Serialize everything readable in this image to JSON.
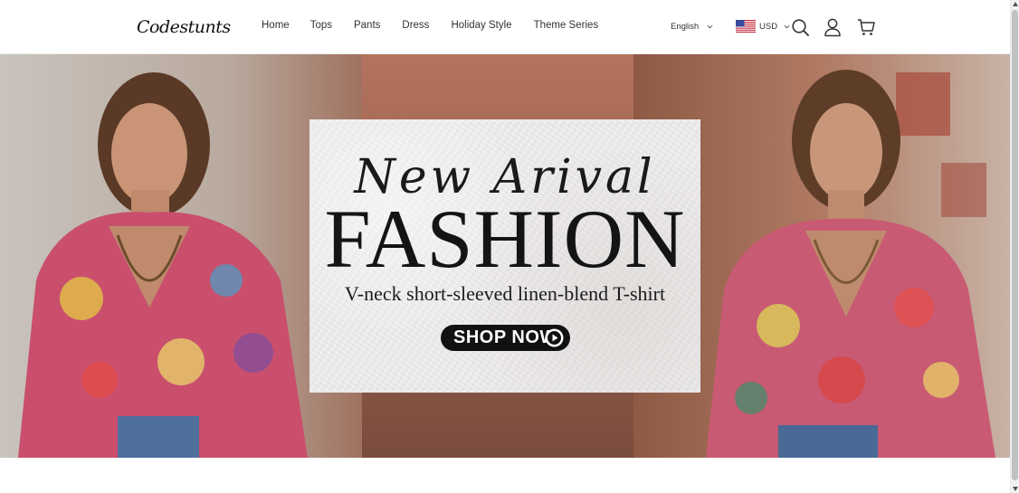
{
  "brand": {
    "name": "Codestunts"
  },
  "nav": {
    "items": [
      {
        "label": "Home"
      },
      {
        "label": "Tops"
      },
      {
        "label": "Pants"
      },
      {
        "label": "Dress"
      },
      {
        "label": "Holiday Style"
      },
      {
        "label": "Theme Series"
      }
    ]
  },
  "header": {
    "language": "English",
    "currency": "USD",
    "flag_icon": "us-flag-icon",
    "icons": [
      "search-icon",
      "account-icon",
      "cart-icon"
    ]
  },
  "hero": {
    "script_text": "New Arival",
    "title": "FASHION",
    "subtitle": "V-neck short-sleeved linen-blend T-shirt",
    "cta_label": "SHOP NOW",
    "cta_icon": "play-circle-icon"
  },
  "colors": {
    "accent": "#111111",
    "card_bg": "#efedec",
    "hero_bg": "#a47a62"
  }
}
